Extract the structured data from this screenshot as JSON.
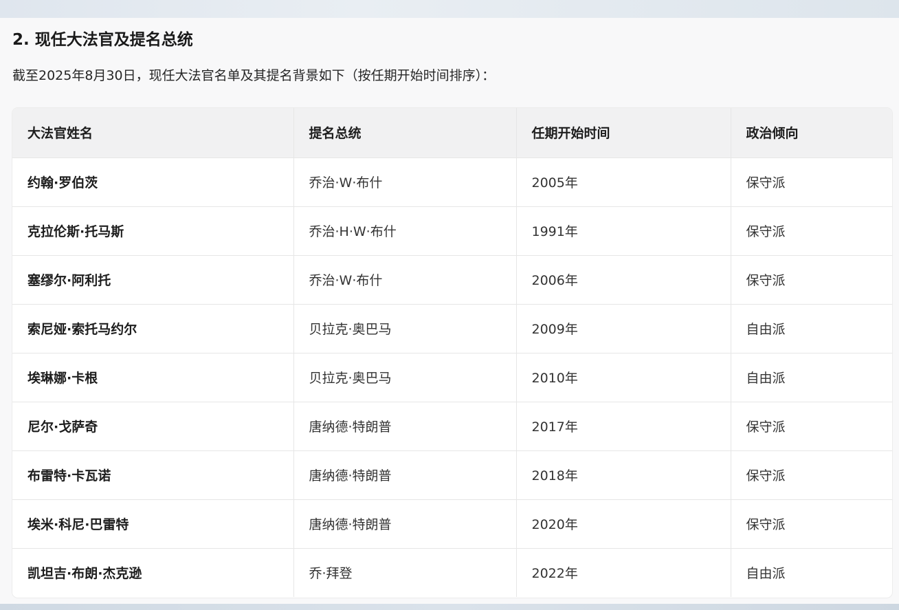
{
  "section": {
    "heading": "2. 现任大法官及提名总统",
    "intro": "截至2025年8月30日，现任大法官名单及其提名背景如下（按任期开始时间排序）："
  },
  "table": {
    "headers": [
      "大法官姓名",
      "提名总统",
      "任期开始时间",
      "政治倾向"
    ],
    "rows": [
      [
        "约翰·罗伯茨",
        "乔治·W·布什",
        "2005年",
        "保守派"
      ],
      [
        "克拉伦斯·托马斯",
        "乔治·H·W·布什",
        "1991年",
        "保守派"
      ],
      [
        "塞缪尔·阿利托",
        "乔治·W·布什",
        "2006年",
        "保守派"
      ],
      [
        "索尼娅·索托马约尔",
        "贝拉克·奥巴马",
        "2009年",
        "自由派"
      ],
      [
        "埃琳娜·卡根",
        "贝拉克·奥巴马",
        "2010年",
        "自由派"
      ],
      [
        "尼尔·戈萨奇",
        "唐纳德·特朗普",
        "2017年",
        "保守派"
      ],
      [
        "布雷特·卡瓦诺",
        "唐纳德·特朗普",
        "2018年",
        "保守派"
      ],
      [
        "埃米·科尼·巴雷特",
        "唐纳德·特朗普",
        "2020年",
        "保守派"
      ],
      [
        "凯坦吉·布朗·杰克逊",
        "乔·拜登",
        "2022年",
        "自由派"
      ]
    ]
  }
}
